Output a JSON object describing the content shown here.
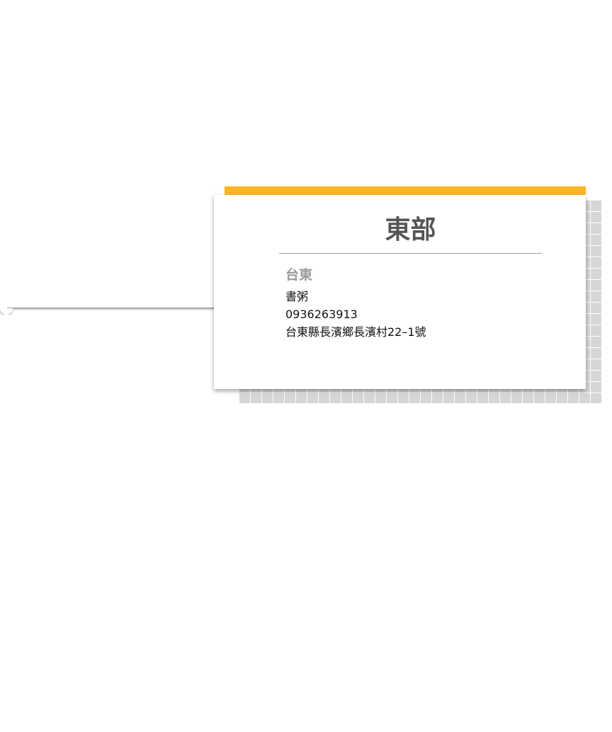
{
  "card": {
    "region_title": "東部",
    "city": "台東",
    "shop_name": "書粥",
    "phone": "0936263913",
    "address": "台東縣長濱鄉長濱村22–1號"
  },
  "colors": {
    "accent": "#fbb623",
    "grid_background": "#d6d6d6",
    "title_text": "#555555",
    "city_text": "#9a9a9a",
    "connector_line": "#a9a9a9"
  }
}
